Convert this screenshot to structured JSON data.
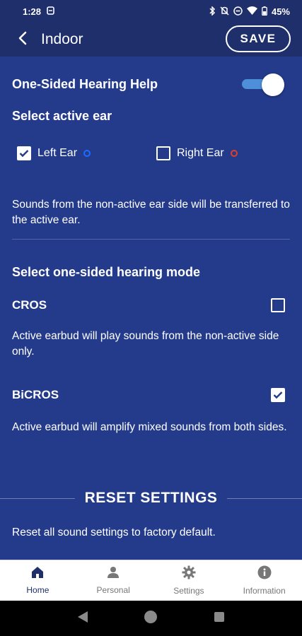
{
  "status": {
    "time": "1:28",
    "battery": "45%",
    "icons": [
      "settings-mini-icon",
      "bluetooth-icon",
      "vibrate-off-icon",
      "dnd-icon",
      "wifi-icon",
      "battery-icon"
    ]
  },
  "header": {
    "title": "Indoor",
    "save_label": "SAVE"
  },
  "one_sided": {
    "label": "One-Sided Hearing Help",
    "enabled": true
  },
  "active_ear": {
    "title": "Select active ear",
    "left_label": "Left Ear",
    "left_checked": true,
    "left_color": "#1e6bff",
    "right_label": "Right Ear",
    "right_checked": false,
    "right_color": "#e0402a",
    "description": "Sounds from the non-active ear side will be transferred to the active ear."
  },
  "mode": {
    "title": "Select one-sided hearing mode",
    "cros_label": "CROS",
    "cros_checked": false,
    "cros_desc": "Active earbud will play sounds from the non-active side only.",
    "bicros_label": "BiCROS",
    "bicros_checked": true,
    "bicros_desc": "Active earbud will amplify mixed sounds from both sides."
  },
  "reset": {
    "title": "RESET SETTINGS",
    "description": "Reset all sound settings to factory default."
  },
  "nav": {
    "home": "Home",
    "personal": "Personal",
    "settings": "Settings",
    "information": "Information",
    "active": "home"
  },
  "colors": {
    "header_bg": "#1f2f6c",
    "content_bg": "#243b8c",
    "accent": "#4d8fd8"
  }
}
